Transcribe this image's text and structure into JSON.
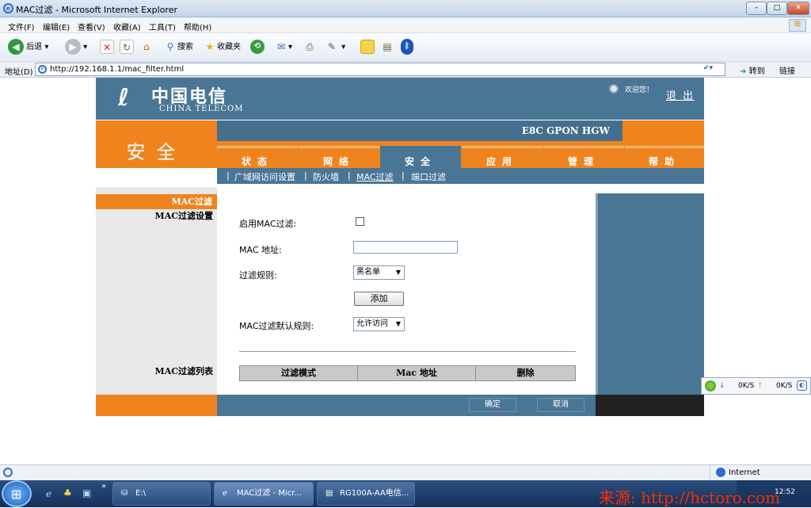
{
  "window": {
    "title": "MAC过滤 - Microsoft Internet Explorer",
    "minimize": "–",
    "maximize": "□",
    "close": "✕"
  },
  "menu": [
    "文件(F)",
    "编辑(E)",
    "查看(V)",
    "收藏(A)",
    "工具(T)",
    "帮助(H)"
  ],
  "toolbar": {
    "back": "后退",
    "search": "搜索",
    "favorites": "收藏夹"
  },
  "address": {
    "label": "地址(D)",
    "url": "http://192.168.1.1/mac_filter.html",
    "go": "转到",
    "links": "链接"
  },
  "page": {
    "logo_cn": "中国电信",
    "logo_en": "CHINA TELECOM",
    "welcome": "欢迎您！",
    "logout": "退 出",
    "product": "E8C GPON HGW",
    "section_title": "安全",
    "tabs": [
      "状态",
      "网络",
      "安全",
      "应用",
      "管理",
      "帮助"
    ],
    "subnav": [
      "广域网访问设置",
      "防火墙",
      "MAC过滤",
      "端口过滤"
    ],
    "left_active": "MAC过滤",
    "left_label_settings": "MAC过滤设置",
    "left_label_list": "MAC过滤列表",
    "form": {
      "enable_label": "启用MAC过滤:",
      "mac_label": "MAC 地址:",
      "mac_value": "",
      "rule_label": "过滤规则:",
      "rule_value": "黑名单",
      "add_button": "添加",
      "default_rule_label": "MAC过滤默认规则:",
      "default_rule_value": "允许访问"
    },
    "table_headers": [
      "过滤模式",
      "Mac 地址",
      "删除"
    ],
    "ok_button": "确定",
    "cancel_button": "取消"
  },
  "netmon": {
    "down": "0K/S",
    "up": "0K/S"
  },
  "status": {
    "zone": "Internet"
  },
  "taskbar": {
    "quick_more": "»",
    "items": [
      "E:\\",
      "MAC过滤 - Micr...",
      "RG100A-AA电信..."
    ],
    "clock": "12:52"
  },
  "watermark": "来源: http://hctoro.com"
}
